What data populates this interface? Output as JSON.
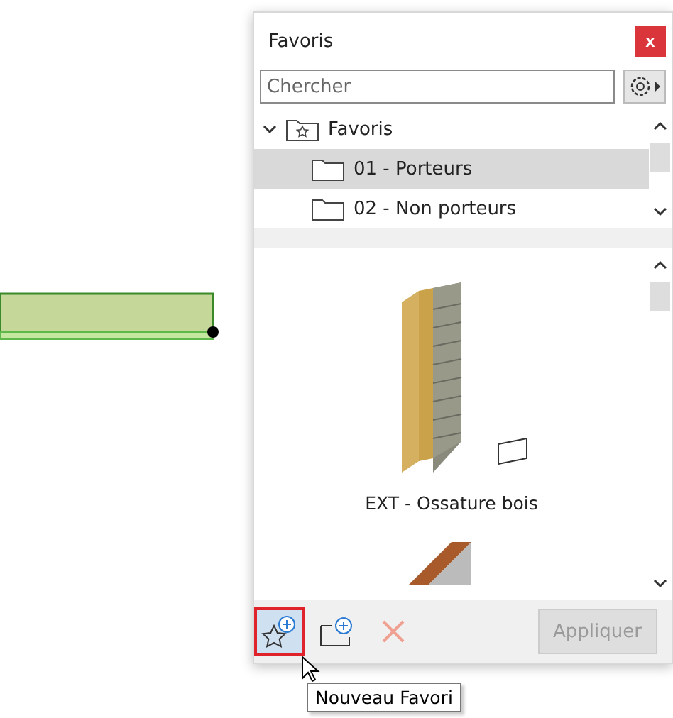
{
  "panel": {
    "title": "Favoris",
    "close": "x"
  },
  "search": {
    "placeholder": "Chercher"
  },
  "tree": {
    "label": "Favoris",
    "expanded": true,
    "children": [
      {
        "label": "01 - Porteurs",
        "selected": true
      },
      {
        "label": "02 - Non porteurs",
        "selected": false
      }
    ]
  },
  "previews": [
    {
      "label": "EXT - Ossature bois",
      "kind": "wall"
    },
    {
      "kind": "beam"
    }
  ],
  "toolbar": {
    "new_favorite": {
      "hovered": true
    },
    "new_folder": {
      "hovered": false
    },
    "delete": {
      "disabled": true
    },
    "apply": {
      "label": "Appliquer",
      "disabled": true
    }
  },
  "tooltip": "Nouveau Favori"
}
